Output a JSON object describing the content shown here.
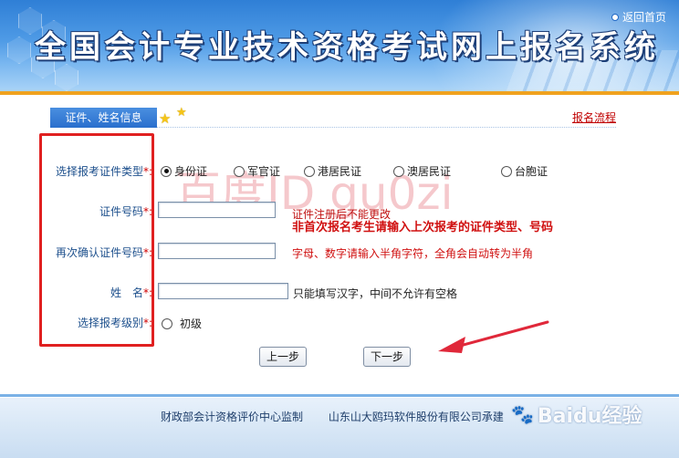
{
  "header": {
    "title": "全国会计专业技术资格考试网上报名系统",
    "back_link": "返回首页"
  },
  "tabs": {
    "active_tab": "证件、姓名信息",
    "flow_link": "报名流程"
  },
  "form": {
    "id_type_label": "选择报考证件类型",
    "id_types": [
      {
        "label": "身份证",
        "selected": true
      },
      {
        "label": "军官证",
        "selected": false
      },
      {
        "label": "港居民证",
        "selected": false
      },
      {
        "label": "澳居民证",
        "selected": false
      },
      {
        "label": "台胞证",
        "selected": false
      }
    ],
    "id_number_label": "证件号码",
    "id_number_value": "",
    "id_number_hint": "证件注册后不能更改",
    "id_number_hint2": "非首次报名考生请输入上次报考的证件类型、号码",
    "confirm_label": "再次确认证件号码",
    "confirm_value": "",
    "confirm_hint": "字母、数字请输入半角字符，全角会自动转为半角",
    "name_label": "姓　名",
    "name_value": "",
    "name_hint": "只能填写汉字，中间不允许有空格",
    "level_label": "选择报考级别",
    "levels": [
      {
        "label": "初级",
        "selected": false
      }
    ],
    "required_mark": "*:"
  },
  "buttons": {
    "prev": "上一步",
    "next": "下一步"
  },
  "watermark": "百度ID gu0zi",
  "footer": {
    "supervisor": "财政部会计资格评价中心监制",
    "builder": "山东山大鸥玛软件股份有限公司承建"
  },
  "brand_mark": {
    "text": "Baidu经验"
  },
  "colors": {
    "header_blue": "#2f7fd6",
    "accent_orange": "#f0a21e",
    "highlight_red": "#e02020",
    "label_blue": "#1c4f8c"
  }
}
